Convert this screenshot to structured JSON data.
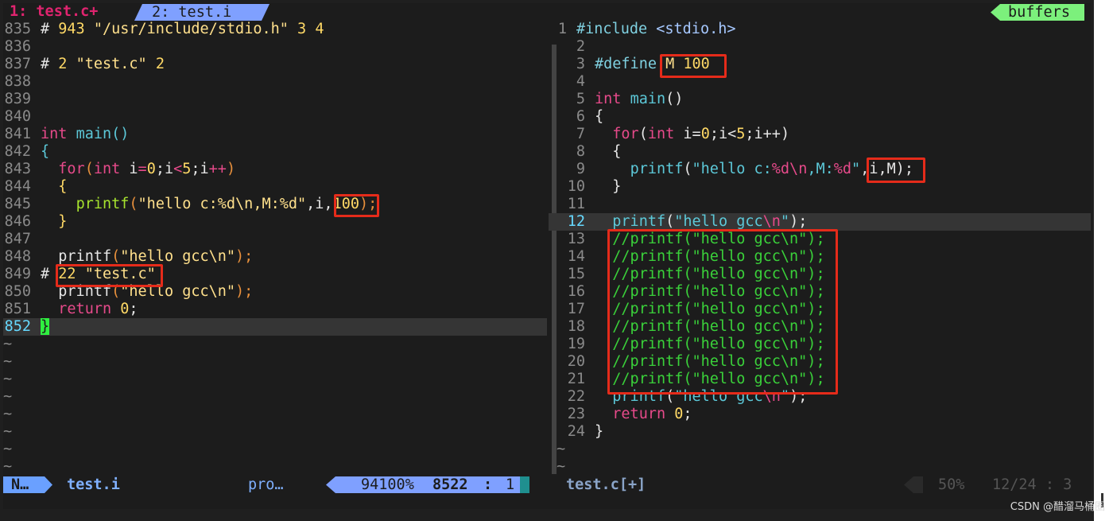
{
  "tabline": {
    "tab1": "1: test.c+",
    "tab2": "2: test.i",
    "buffers": "buffers"
  },
  "left_pane": {
    "lines": [
      {
        "n": "835",
        "t": "# 943 \"/usr/include/stdio.h\" 3 4"
      },
      {
        "n": "836",
        "t": ""
      },
      {
        "n": "837",
        "t": "# 2 \"test.c\" 2"
      },
      {
        "n": "838",
        "t": ""
      },
      {
        "n": "839",
        "t": ""
      },
      {
        "n": "840",
        "t": ""
      },
      {
        "n": "841",
        "t": "int main()"
      },
      {
        "n": "842",
        "t": "{"
      },
      {
        "n": "843",
        "t": "  for(int i=0;i<5;i++)"
      },
      {
        "n": "844",
        "t": "  {"
      },
      {
        "n": "845",
        "t": "    printf(\"hello c:%d\\n,M:%d\",i,100);"
      },
      {
        "n": "846",
        "t": "  }"
      },
      {
        "n": "847",
        "t": ""
      },
      {
        "n": "848",
        "t": "  printf(\"hello gcc\\n\");"
      },
      {
        "n": "849",
        "t": "# 22 \"test.c\""
      },
      {
        "n": "850",
        "t": "  printf(\"hello gcc\\n\");"
      },
      {
        "n": "851",
        "t": "  return 0;"
      },
      {
        "n": "852",
        "t": "}"
      }
    ],
    "tilde": "~"
  },
  "right_pane": {
    "lines": [
      {
        "n": "1",
        "t": "#include <stdio.h>"
      },
      {
        "n": "2",
        "t": ""
      },
      {
        "n": "3",
        "t": "#define M 100"
      },
      {
        "n": "4",
        "t": ""
      },
      {
        "n": "5",
        "t": "int main()"
      },
      {
        "n": "6",
        "t": "{"
      },
      {
        "n": "7",
        "t": "  for(int i=0;i<5;i++)"
      },
      {
        "n": "8",
        "t": "  {"
      },
      {
        "n": "9",
        "t": "    printf(\"hello c:%d\\n,M:%d\",i,M);"
      },
      {
        "n": "10",
        "t": "  }"
      },
      {
        "n": "11",
        "t": ""
      },
      {
        "n": "12",
        "t": "  printf(\"hello gcc\\n\");"
      },
      {
        "n": "13",
        "t": "  //printf(\"hello gcc\\n\");"
      },
      {
        "n": "14",
        "t": "  //printf(\"hello gcc\\n\");"
      },
      {
        "n": "15",
        "t": "  //printf(\"hello gcc\\n\");"
      },
      {
        "n": "16",
        "t": "  //printf(\"hello gcc\\n\");"
      },
      {
        "n": "17",
        "t": "  //printf(\"hello gcc\\n\");"
      },
      {
        "n": "18",
        "t": "  //printf(\"hello gcc\\n\");"
      },
      {
        "n": "19",
        "t": "  //printf(\"hello gcc\\n\");"
      },
      {
        "n": "20",
        "t": "  //printf(\"hello gcc\\n\");"
      },
      {
        "n": "21",
        "t": "  //printf(\"hello gcc\\n\");"
      },
      {
        "n": "22",
        "t": "  printf(\"hello gcc\\n\");"
      },
      {
        "n": "23",
        "t": "  return 0;"
      },
      {
        "n": "24",
        "t": "}"
      }
    ]
  },
  "statusline": {
    "mode": "N…",
    "left_file": "test.i",
    "filetype": "pro…",
    "percent": "94100%",
    "line": "8522",
    "sep": ":",
    "col": "1",
    "right_file": "test.c[+]",
    "right_percent": "50%",
    "right_pos": "12/24 :  3"
  },
  "watermark": "CSDN @醋溜马桶圈",
  "colors": {
    "annotation_box": "#e52b1a",
    "cursor": "#2ff040",
    "tab_accent": "#7fa0ff"
  }
}
